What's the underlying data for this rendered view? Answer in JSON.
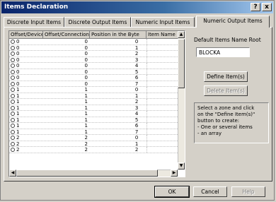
{
  "window": {
    "title": "Items Declaration",
    "help_btn": "?",
    "close_btn": "x"
  },
  "tabs": [
    {
      "label": "Discrete Input Items"
    },
    {
      "label": "Discrete Output Items"
    },
    {
      "label": "Numeric Input Items"
    },
    {
      "label": "Numeric Output Items"
    }
  ],
  "table": {
    "headers": [
      "Offset/Device",
      "Offset/Connection",
      "Position in the Byte",
      "Item Name"
    ],
    "rows": [
      {
        "d": "0",
        "c": "0",
        "p": "0"
      },
      {
        "d": "0",
        "c": "0",
        "p": "1"
      },
      {
        "d": "0",
        "c": "0",
        "p": "2"
      },
      {
        "d": "0",
        "c": "0",
        "p": "3"
      },
      {
        "d": "0",
        "c": "0",
        "p": "4"
      },
      {
        "d": "0",
        "c": "0",
        "p": "5"
      },
      {
        "d": "0",
        "c": "0",
        "p": "6"
      },
      {
        "d": "0",
        "c": "0",
        "p": "7"
      },
      {
        "d": "1",
        "c": "1",
        "p": "0"
      },
      {
        "d": "1",
        "c": "1",
        "p": "1"
      },
      {
        "d": "1",
        "c": "1",
        "p": "2"
      },
      {
        "d": "1",
        "c": "1",
        "p": "3"
      },
      {
        "d": "1",
        "c": "1",
        "p": "4"
      },
      {
        "d": "1",
        "c": "1",
        "p": "5"
      },
      {
        "d": "1",
        "c": "1",
        "p": "6"
      },
      {
        "d": "1",
        "c": "1",
        "p": "7"
      },
      {
        "d": "2",
        "c": "2",
        "p": "0"
      },
      {
        "d": "2",
        "c": "2",
        "p": "1"
      },
      {
        "d": "2",
        "c": "2",
        "p": "2"
      }
    ]
  },
  "side": {
    "root_label": "Default Items Name Root",
    "root_value": "BLOCKA",
    "define_btn": "Define Item(s)",
    "delete_btn": "Delete Item(s)",
    "info_lines": [
      "Select a zone and click",
      "on the \"Define Item(s)\"",
      "button to create:",
      "- One or several items",
      "- an array"
    ]
  },
  "footer": {
    "ok": "OK",
    "cancel": "Cancel",
    "help": "Help"
  }
}
